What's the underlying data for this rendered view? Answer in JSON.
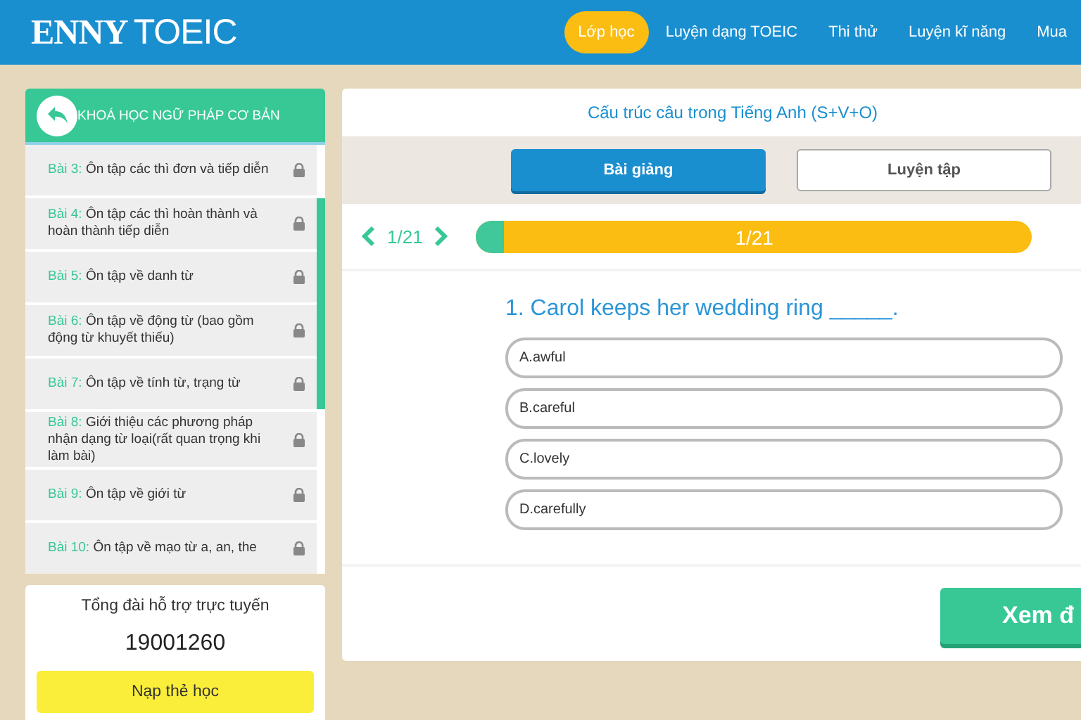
{
  "header": {
    "logo_bold": "ENNY",
    "logo_light": "TOEIC",
    "nav": [
      {
        "label": "Lớp học",
        "selected": true
      },
      {
        "label": "Luyện dạng TOEIC",
        "selected": false
      },
      {
        "label": "Thi thử",
        "selected": false
      },
      {
        "label": "Luyện kĩ năng",
        "selected": false
      },
      {
        "label": "Mua",
        "selected": false
      }
    ]
  },
  "sidebar": {
    "title": "KHOÁ HỌC NGỮ PHÁP CƠ BẢN",
    "lessons": [
      {
        "number": "Bài 3:",
        "title": "Ôn tập các thì đơn và tiếp diễn",
        "locked": true
      },
      {
        "number": "Bài 4:",
        "title": "Ôn tập các thì hoàn thành và hoàn thành tiếp diễn",
        "locked": true
      },
      {
        "number": "Bài 5:",
        "title": "Ôn tập về danh từ",
        "locked": true
      },
      {
        "number": "Bài 6:",
        "title": "Ôn tập về động từ (bao gồm động từ khuyết thiếu)",
        "locked": true
      },
      {
        "number": "Bài 7:",
        "title": "Ôn tập về tính từ, trạng từ",
        "locked": true
      },
      {
        "number": "Bài 8:",
        "title": "Giới thiệu các phương pháp nhận dạng từ loại(rất quan trọng khi làm bài)",
        "locked": true
      },
      {
        "number": "Bài 9:",
        "title": "Ôn tập về giới từ",
        "locked": true
      },
      {
        "number": "Bài 10:",
        "title": "Ôn tập về mạo từ a, an, the",
        "locked": true
      }
    ]
  },
  "support": {
    "title": "Tổng đài hỗ trợ trực tuyến",
    "phone": "19001260",
    "button": "Nạp thẻ học"
  },
  "lesson": {
    "title": "Cấu trúc câu trong Tiếng Anh (S+V+O)",
    "tabs": [
      {
        "label": "Bài giảng",
        "selected": true
      },
      {
        "label": "Luyện tập",
        "selected": false
      }
    ],
    "pager": "1/21",
    "progress": {
      "level": 0.05,
      "reading": "1/21"
    },
    "question": "1. Carol keeps her wedding ring _____.",
    "options": [
      {
        "label": "A.awful",
        "selected": false
      },
      {
        "label": "B.careful",
        "selected": false
      },
      {
        "label": "C.lovely",
        "selected": false
      },
      {
        "label": "D.carefully",
        "selected": false
      }
    ],
    "submit": "Xem đ"
  }
}
